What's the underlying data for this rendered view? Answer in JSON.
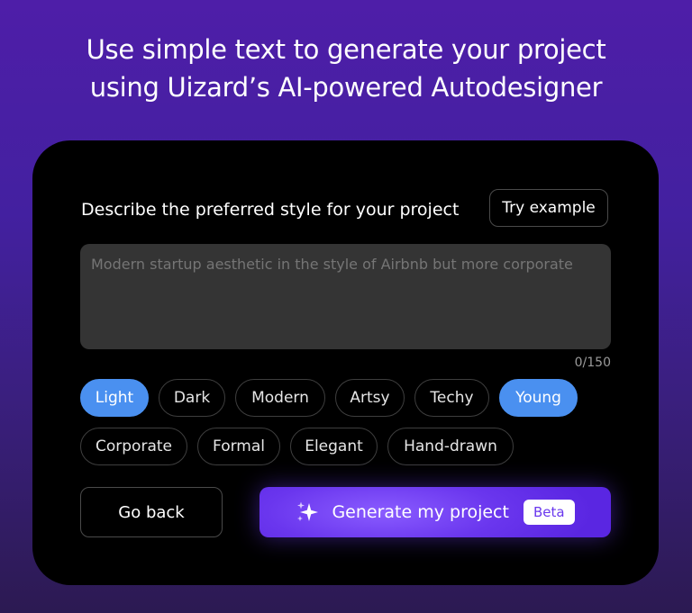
{
  "headline": {
    "line1": "Use simple text to generate your project",
    "line2": "using Uizard’s AI-powered Autodesigner"
  },
  "form": {
    "label": "Describe the preferred style for your project",
    "try_example": "Try example",
    "placeholder": "Modern startup aesthetic in the style of Airbnb but more corporate",
    "value": "",
    "counter": "0/150"
  },
  "chips": [
    {
      "label": "Light",
      "selected": true
    },
    {
      "label": "Dark",
      "selected": false
    },
    {
      "label": "Modern",
      "selected": false
    },
    {
      "label": "Artsy",
      "selected": false
    },
    {
      "label": "Techy",
      "selected": false
    },
    {
      "label": "Young",
      "selected": true
    },
    {
      "label": "Corporate",
      "selected": false
    },
    {
      "label": "Formal",
      "selected": false
    },
    {
      "label": "Elegant",
      "selected": false
    },
    {
      "label": "Hand-drawn",
      "selected": false
    }
  ],
  "actions": {
    "back": "Go back",
    "generate": "Generate my project",
    "badge": "Beta"
  },
  "colors": {
    "accent_selected_chip": "#4a90f0",
    "generate_button": "#6a36ee",
    "card_background": "#000000"
  },
  "icons": {
    "generate": "sparkle-icon"
  }
}
